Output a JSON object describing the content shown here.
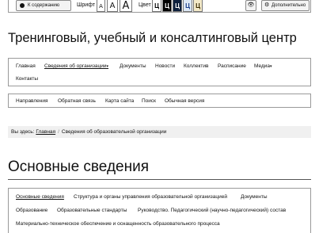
{
  "accessibility_bar": {
    "back_label": "К содержанию",
    "font_label": "Шрифт",
    "font_sizes": [
      "A",
      "A",
      "A"
    ],
    "color_label": "Цвет",
    "color_options": [
      {
        "glyph": "Ц",
        "bg": "#ffffff",
        "fg": "#000000"
      },
      {
        "glyph": "Ц",
        "bg": "#000000",
        "fg": "#ffffff"
      },
      {
        "glyph": "Ц",
        "bg": "#0d1f3c",
        "fg": "#ffffff"
      },
      {
        "glyph": "Ц",
        "bg": "#dce8f5",
        "fg": "#1a3e8a"
      },
      {
        "glyph": "Ц",
        "bg": "#f3e9c8",
        "fg": "#3a2a00"
      }
    ],
    "images_icon": "eye-off-icon",
    "more_label": "Дополнительно"
  },
  "site_title": "Тренинговый, учебный и консалтинговый центр",
  "main_nav": {
    "items": [
      "Главная",
      "Сведения об организации",
      "Документы",
      "Новости",
      "Коллектив",
      "Расписание",
      "Медиа",
      "Контакты"
    ],
    "active": "Сведения об организации"
  },
  "secondary_nav": {
    "items": [
      "Направления",
      "Обратная связь",
      "Карта сайта",
      "Поиск",
      "Обычная версия"
    ]
  },
  "breadcrumb": {
    "prefix": "Вы здесь:",
    "home": "Главная",
    "current": "Сведения об образовательной организации"
  },
  "section_title": "Основные сведения",
  "sub_nav": {
    "items": [
      "Основные сведения",
      "Структура и органы управления образовательной организацией",
      "Документы",
      "Образование",
      "Образовательные стандарты",
      "Руководство. Педагогический (научно-педагогический) состав",
      "Материально-техническое обеспечение и оснащенность образовательного процесса"
    ],
    "active": "Основные сведения"
  }
}
